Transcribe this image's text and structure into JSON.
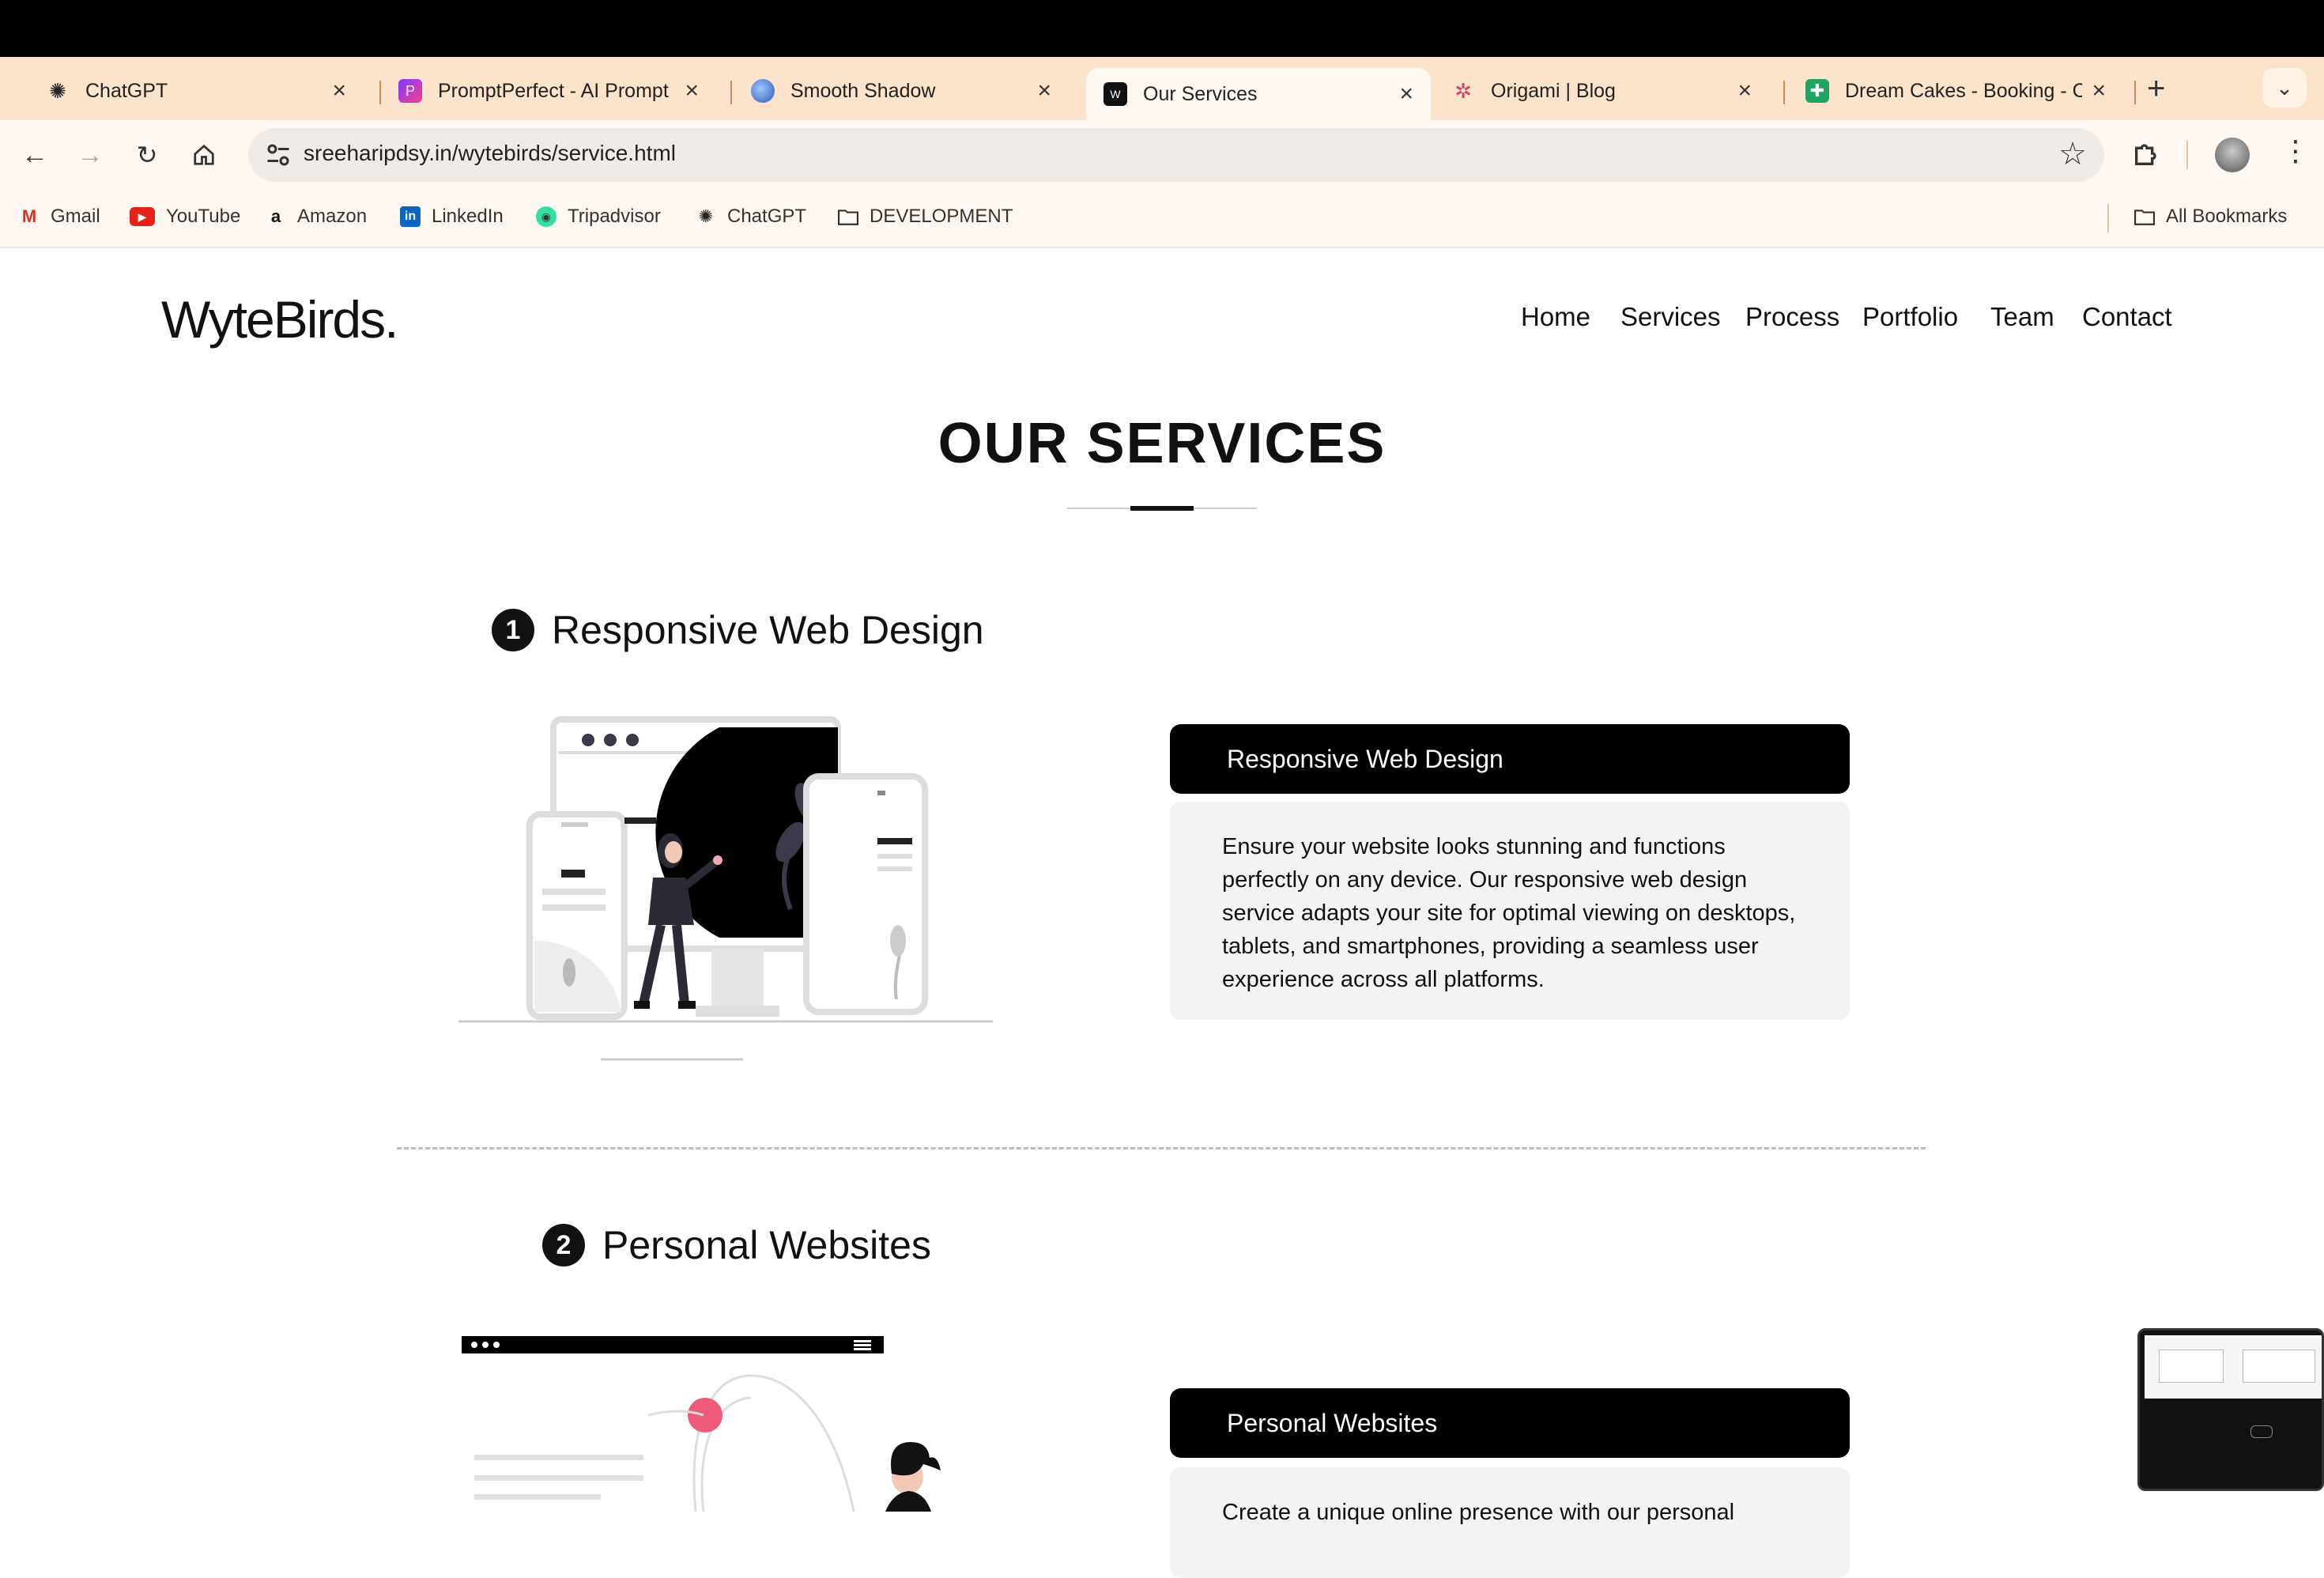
{
  "browser": {
    "tabs": [
      {
        "title": "ChatGPT",
        "icon": "chatgpt-icon",
        "active": false
      },
      {
        "title": "PromptPerfect - AI Prompt",
        "icon": "promptperfect-icon",
        "active": false
      },
      {
        "title": "Smooth Shadow",
        "icon": "smooth-shadow-icon",
        "active": false
      },
      {
        "title": "Our Services",
        "icon": "site-icon",
        "active": true
      },
      {
        "title": "Origami | Blog",
        "icon": "origami-icon",
        "active": false
      },
      {
        "title": "Dream Cakes - Booking - C",
        "icon": "sheets-icon",
        "active": false
      }
    ],
    "url": "sreeharipdsy.in/wytebirds/service.html",
    "bookmarks": [
      {
        "label": "Gmail",
        "icon": "gmail-icon"
      },
      {
        "label": "YouTube",
        "icon": "youtube-icon"
      },
      {
        "label": "Amazon",
        "icon": "amazon-icon"
      },
      {
        "label": "LinkedIn",
        "icon": "linkedin-icon"
      },
      {
        "label": "Tripadvisor",
        "icon": "tripadvisor-icon"
      },
      {
        "label": "ChatGPT",
        "icon": "chatgpt-icon"
      },
      {
        "label": "DEVELOPMENT",
        "icon": "folder-icon"
      }
    ],
    "all_bookmarks": "All Bookmarks",
    "colors": {
      "tabstrip": "#fbe3cc",
      "toolbar": "#fff8f2"
    }
  },
  "site": {
    "logo": "WyteBirds.",
    "nav": [
      "Home",
      "Services",
      "Process",
      "Portfolio",
      "Team",
      "Contact"
    ],
    "page_title": "OUR SERVICES",
    "services": [
      {
        "number": "1",
        "heading": "Responsive Web Design",
        "card_title": "Responsive Web Design",
        "description": "Ensure your website looks stunning and functions perfectly on any device. Our responsive web design service adapts your site for optimal viewing on desktops, tablets, and smartphones, providing a seamless user experience across all platforms."
      },
      {
        "number": "2",
        "heading": "Personal Websites",
        "card_title": "Personal Websites",
        "description": "Create a unique online presence with our personal"
      }
    ]
  }
}
